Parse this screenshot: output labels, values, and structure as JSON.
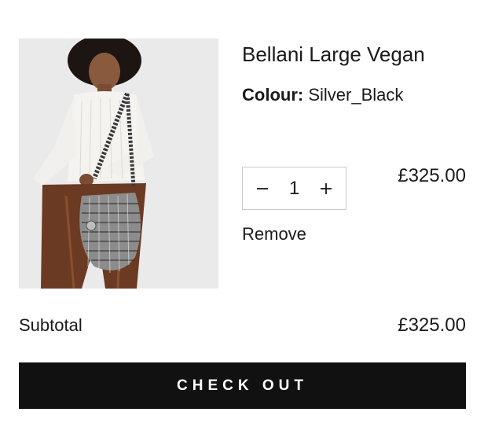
{
  "cart_item": {
    "title": "Bellani Large Vegan",
    "colour_label": "Colour:",
    "colour_value": "Silver_Black",
    "quantity": "1",
    "decrement_symbol": "−",
    "increment_symbol": "+",
    "price": "£325.00",
    "remove_label": "Remove",
    "image_icon": "product-photo"
  },
  "summary": {
    "subtotal_label": "Subtotal",
    "subtotal_value": "£325.00"
  },
  "checkout": {
    "label": "CHECK OUT",
    "background": "#111111",
    "text_color": "#ffffff"
  }
}
